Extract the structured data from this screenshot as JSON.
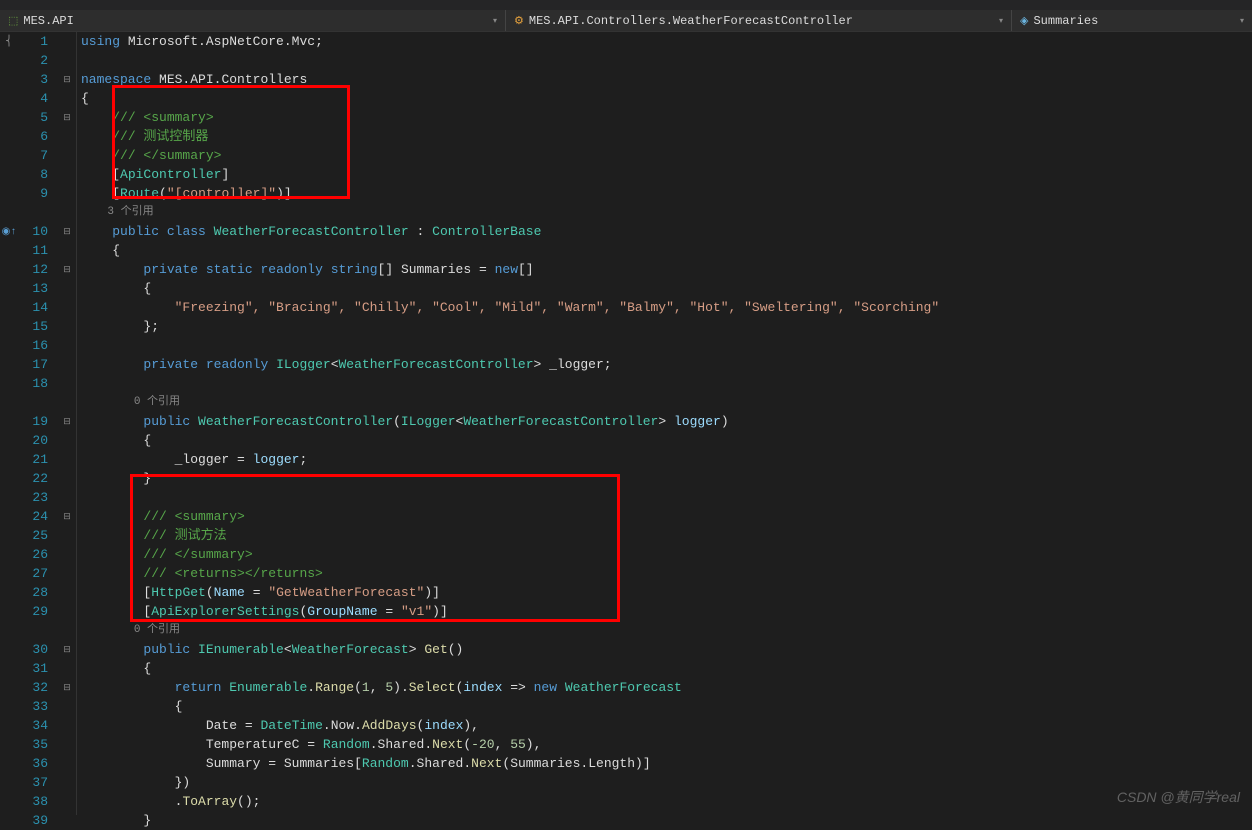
{
  "nav": {
    "project": "MES.API",
    "class": "MES.API.Controllers.WeatherForecastController",
    "member": "Summaries"
  },
  "code": {
    "usings": "using Microsoft.AspNetCore.Mvc;",
    "namespace": {
      "keyword": "namespace",
      "name": "MES.API.Controllers"
    },
    "summary1": {
      "open": "/// <summary>",
      "text": "/// 测试控制器",
      "close": "/// </summary>"
    },
    "attrs1": {
      "api": "[ApiController]",
      "route_open": "[Route(",
      "route_str": "\"[controller]\"",
      "route_close": ")]"
    },
    "ref1": "3 个引用",
    "class_decl": {
      "modifiers": "public class",
      "name": "WeatherForecastController",
      "colon": " : ",
      "base": "ControllerBase"
    },
    "summaries_field": {
      "modifiers": "private static readonly",
      "type": "string",
      "brackets": "[]",
      "name": "Summaries",
      "eq": " = ",
      "new": "new",
      "init": "[]"
    },
    "summaries_values": "\"Freezing\", \"Bracing\", \"Chilly\", \"Cool\", \"Mild\", \"Warm\", \"Balmy\", \"Hot\", \"Sweltering\", \"Scorching\"",
    "logger_field": {
      "modifiers": "private readonly",
      "type": "ILogger",
      "generic": "WeatherForecastController",
      "name": "_logger;"
    },
    "ref2": "0 个引用",
    "ctor": {
      "modifiers": "public",
      "name": "WeatherForecastController",
      "param_type": "ILogger",
      "param_generic": "WeatherForecastController",
      "param_name": "logger"
    },
    "ctor_body": "_logger = logger;",
    "summary2": {
      "open": "/// <summary>",
      "text": "/// 测试方法",
      "close": "/// </summary>",
      "returns": "/// <returns></returns>"
    },
    "attrs2": {
      "httpget_open": "[HttpGet(",
      "httpget_name": "Name",
      "httpget_eq": " = ",
      "httpget_str": "\"GetWeatherForecast\"",
      "httpget_close": ")]",
      "apiexp_open": "[ApiExplorerSettings(",
      "apiexp_name": "GroupName",
      "apiexp_eq": " = ",
      "apiexp_str": "\"v1\"",
      "apiexp_close": ")]"
    },
    "ref3": "0 个引用",
    "get_method": {
      "modifiers": "public",
      "ret_type": "IEnumerable",
      "ret_generic": "WeatherForecast",
      "name": "Get",
      "params": "()"
    },
    "return_stmt": {
      "return": "return",
      "enumerable": "Enumerable",
      "range": ".Range(",
      "args": "1, 5",
      "select": ").Select(",
      "index": "index",
      "lambda": " => ",
      "new": "new",
      "type": "WeatherForecast"
    },
    "props": {
      "date": {
        "name": "Date",
        "eq": " = ",
        "dt": "DateTime",
        "now": ".Now.",
        "method": "AddDays",
        "args": "(index),"
      },
      "temp": {
        "name": "TemperatureC",
        "eq": " = ",
        "random": "Random",
        "shared": ".Shared.",
        "next": "Next",
        "args": "(-20, 55),"
      },
      "summary": {
        "name": "Summary",
        "eq": " = ",
        "field": "Summaries",
        "open": "[",
        "random": "Random",
        "shared": ".Shared.",
        "next": "Next",
        "args": "(Summaries.Length)]"
      }
    },
    "toarray": ".ToArray();"
  },
  "line_count": 39,
  "watermark": "CSDN @黄同学real"
}
